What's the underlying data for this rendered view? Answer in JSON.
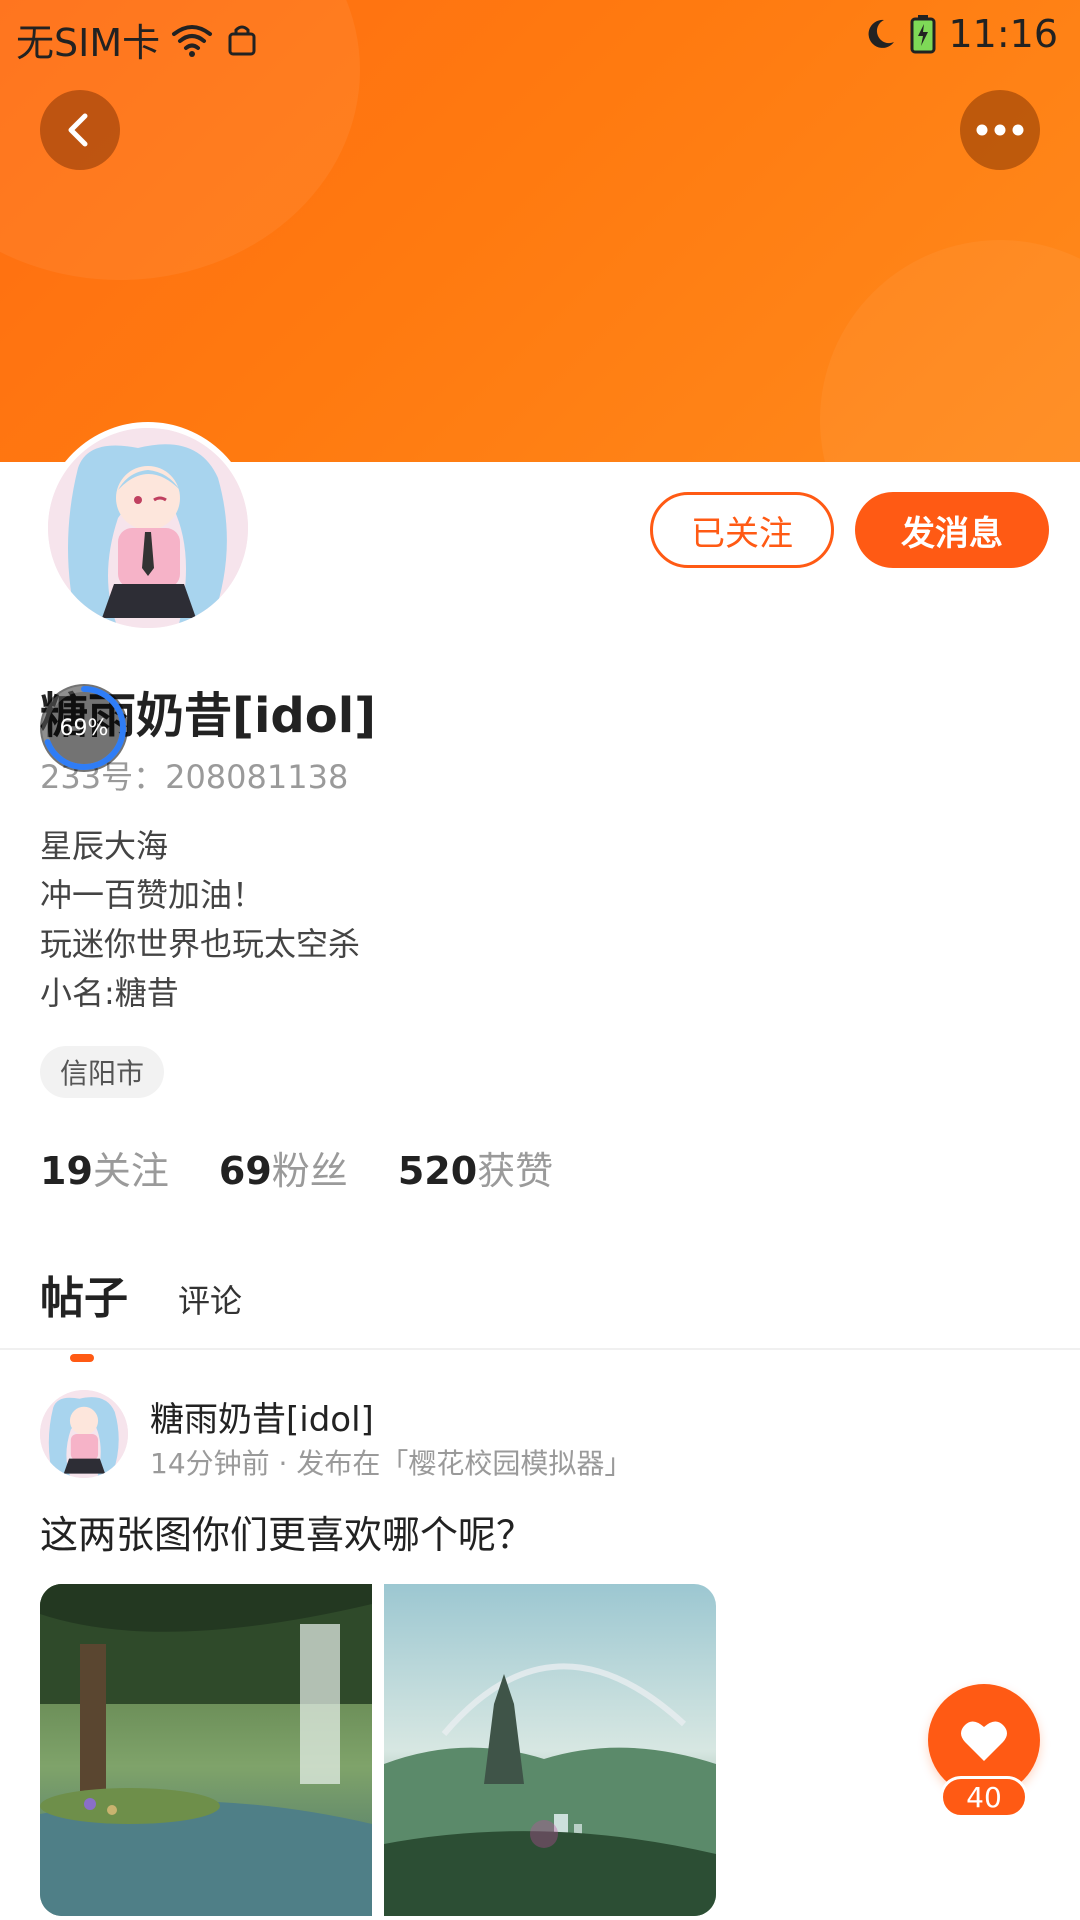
{
  "status_bar": {
    "carrier": "无SIM卡",
    "time": "11:16"
  },
  "profile": {
    "followed_label": "已关注",
    "message_label": "发消息",
    "username": "糖雨奶昔[idol]",
    "uid": "233号：208081138",
    "progress_badge": "69%",
    "progress_value": 0.69,
    "bio_lines": [
      "星辰大海",
      "冲一百赞加油！",
      "玩迷你世界也玩太空杀",
      "小名:糖昔"
    ],
    "location": "信阳市",
    "stats": [
      {
        "num": "19",
        "label": "关注"
      },
      {
        "num": "69",
        "label": "粉丝"
      },
      {
        "num": "520",
        "label": "获赞"
      }
    ]
  },
  "tabs": [
    {
      "label": "帖子",
      "active": true
    },
    {
      "label": "评论",
      "active": false
    }
  ],
  "post": {
    "author": "糖雨奶昔[idol]",
    "meta": "14分钟前 · 发布在「樱花校园模拟器」",
    "text": "这两张图你们更喜欢哪个呢？"
  },
  "like": {
    "count": "40"
  },
  "colors": {
    "accent": "#ff5a14",
    "header": "#ff7a10"
  },
  "icons": [
    "back-arrow-icon",
    "more-dots-icon",
    "wifi-icon",
    "moon-icon",
    "battery-icon",
    "heart-icon",
    "bag-icon"
  ]
}
